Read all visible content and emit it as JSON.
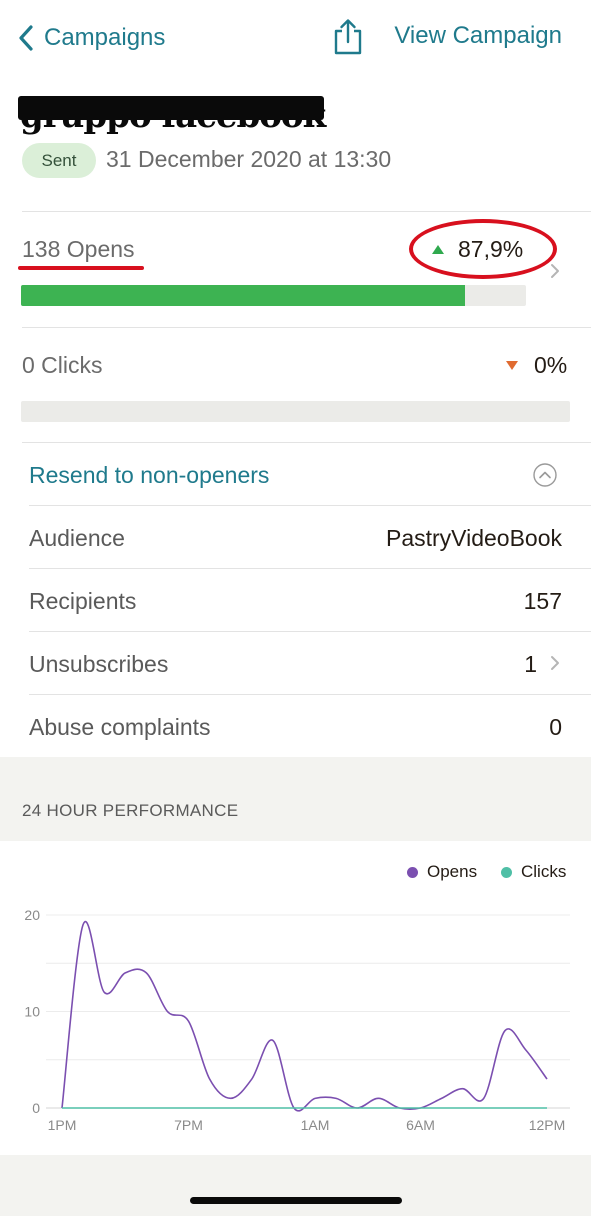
{
  "nav": {
    "back_label": "Campaigns",
    "view_label": "View Campaign"
  },
  "campaign": {
    "title_obscured": "gruppo facebook",
    "status": "Sent",
    "sent_date": "31 December 2020 at 13:30"
  },
  "stats": {
    "opens": {
      "label": "138 Opens",
      "percent": "87,9%",
      "fraction": 0.879,
      "trend": "up"
    },
    "clicks": {
      "label": "0 Clicks",
      "percent": "0%",
      "fraction": 0.0,
      "trend": "down"
    }
  },
  "resend": {
    "label": "Resend to non-openers"
  },
  "details": [
    {
      "label": "Audience",
      "value": "PastryVideoBook"
    },
    {
      "label": "Recipients",
      "value": "157"
    },
    {
      "label": "Unsubscribes",
      "value": "1"
    },
    {
      "label": "Abuse complaints",
      "value": "0"
    }
  ],
  "performance": {
    "title": "24 HOUR PERFORMANCE"
  },
  "colors": {
    "accent": "#1f7a8c",
    "opens_bar": "#3db352",
    "opens_series": "#7b4fb0",
    "clicks_series": "#4fbfa6",
    "annotation": "#d8101e"
  },
  "chart_data": {
    "type": "line",
    "legend": "top-right",
    "x_tick_labels": [
      "1PM",
      "7PM",
      "1AM",
      "6AM",
      "12PM"
    ],
    "x_tick_hours": [
      0,
      6,
      12,
      17,
      23
    ],
    "y_ticks": [
      0,
      10,
      20
    ],
    "ylim": [
      0,
      20
    ],
    "xlim": [
      0,
      23
    ],
    "grid": true,
    "series": [
      {
        "name": "Opens",
        "color": "#7b4fb0",
        "x": [
          0,
          1,
          2,
          3,
          4,
          5,
          6,
          7,
          8,
          9,
          10,
          11,
          12,
          13,
          14,
          15,
          16,
          17,
          18,
          19,
          20,
          21,
          22,
          23
        ],
        "values": [
          0,
          19,
          12,
          14,
          14,
          10,
          9,
          3,
          1,
          3,
          7,
          0,
          1,
          1,
          0,
          1,
          0,
          0,
          1,
          2,
          1,
          8,
          6,
          3
        ]
      },
      {
        "name": "Clicks",
        "color": "#4fbfa6",
        "x": [
          0,
          23
        ],
        "values": [
          0,
          0
        ]
      }
    ]
  }
}
